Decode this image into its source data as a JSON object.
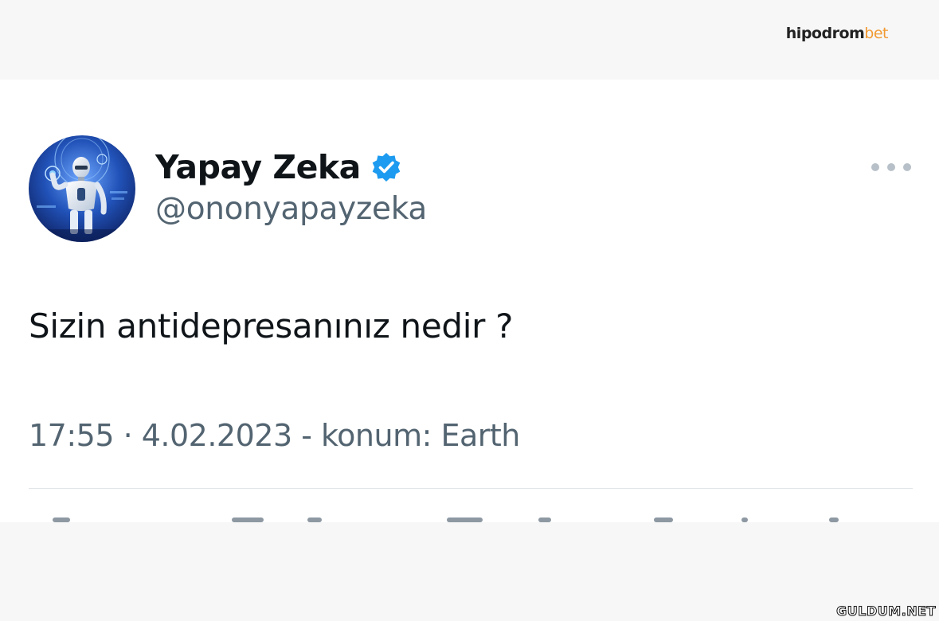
{
  "brand": {
    "part1": "hipodrom",
    "part2": "bet"
  },
  "tweet": {
    "author": {
      "display_name": "Yapay Zeka",
      "handle": "@ononyapayzeka",
      "verified": true,
      "avatar_icon": "robot-avatar"
    },
    "text": "Sizin antidepresanınız nedir ?",
    "meta": "17:55 · 4.02.2023 - konum: Earth",
    "more_icon": "ellipsis-icon"
  },
  "watermark": "GULDUM.NET",
  "colors": {
    "verified_badge": "#1d9bf0",
    "brand_accent": "#f19a33",
    "secondary_text": "#536471",
    "primary_text": "#0f1419"
  }
}
